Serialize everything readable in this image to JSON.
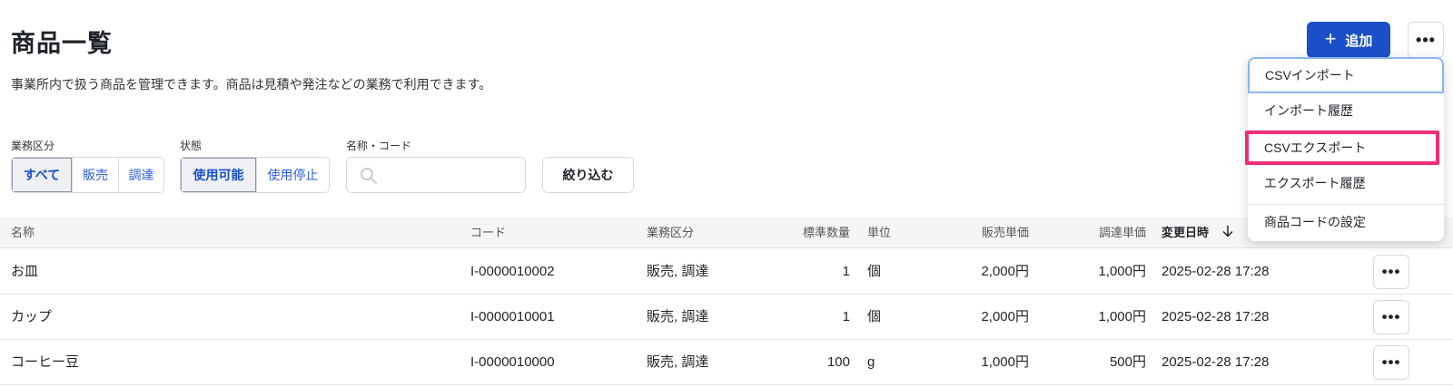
{
  "page": {
    "title": "商品一覧",
    "description": "事業所内で扱う商品を管理できます。商品は見積や発注などの業務で利用できます。"
  },
  "toolbar": {
    "add_label": "追加",
    "add_icon": "plus-icon",
    "more_label": "•••",
    "accent_color": "#1a4fc9"
  },
  "filters": {
    "business_type": {
      "label": "業務区分",
      "options": [
        "すべて",
        "販売",
        "調達"
      ],
      "selected": "すべて"
    },
    "status": {
      "label": "状態",
      "options": [
        "使用可能",
        "使用停止"
      ],
      "selected": "使用可能"
    },
    "name_code": {
      "label": "名称・コード",
      "value": "",
      "placeholder": ""
    },
    "apply_label": "絞り込む"
  },
  "table": {
    "headers": {
      "name": "名称",
      "code": "コード",
      "business_type": "業務区分",
      "standard_qty": "標準数量",
      "unit": "単位",
      "sales_price": "販売単価",
      "purchase_price": "調達単価",
      "updated_at": "変更日時",
      "sort_icon": "arrow-down-icon"
    },
    "rows": [
      {
        "name": "お皿",
        "code": "I-0000010002",
        "business_type": "販売, 調達",
        "standard_qty": "1",
        "unit": "個",
        "sales_price": "2,000円",
        "purchase_price": "1,000円",
        "updated_at": "2025-02-28 17:28"
      },
      {
        "name": "カップ",
        "code": "I-0000010001",
        "business_type": "販売, 調達",
        "standard_qty": "1",
        "unit": "個",
        "sales_price": "2,000円",
        "purchase_price": "1,000円",
        "updated_at": "2025-02-28 17:28"
      },
      {
        "name": "コーヒー豆",
        "code": "I-0000010000",
        "business_type": "販売, 調達",
        "standard_qty": "100",
        "unit": "g",
        "sales_price": "1,000円",
        "purchase_price": "500円",
        "updated_at": "2025-02-28 17:28"
      }
    ],
    "row_more_label": "•••"
  },
  "dropdown_menu": {
    "items": [
      "CSVインポート",
      "インポート履歴",
      "CSVエクスポート",
      "エクスポート履歴",
      "商品コードの設定"
    ],
    "highlight_color": "#f02d76"
  }
}
